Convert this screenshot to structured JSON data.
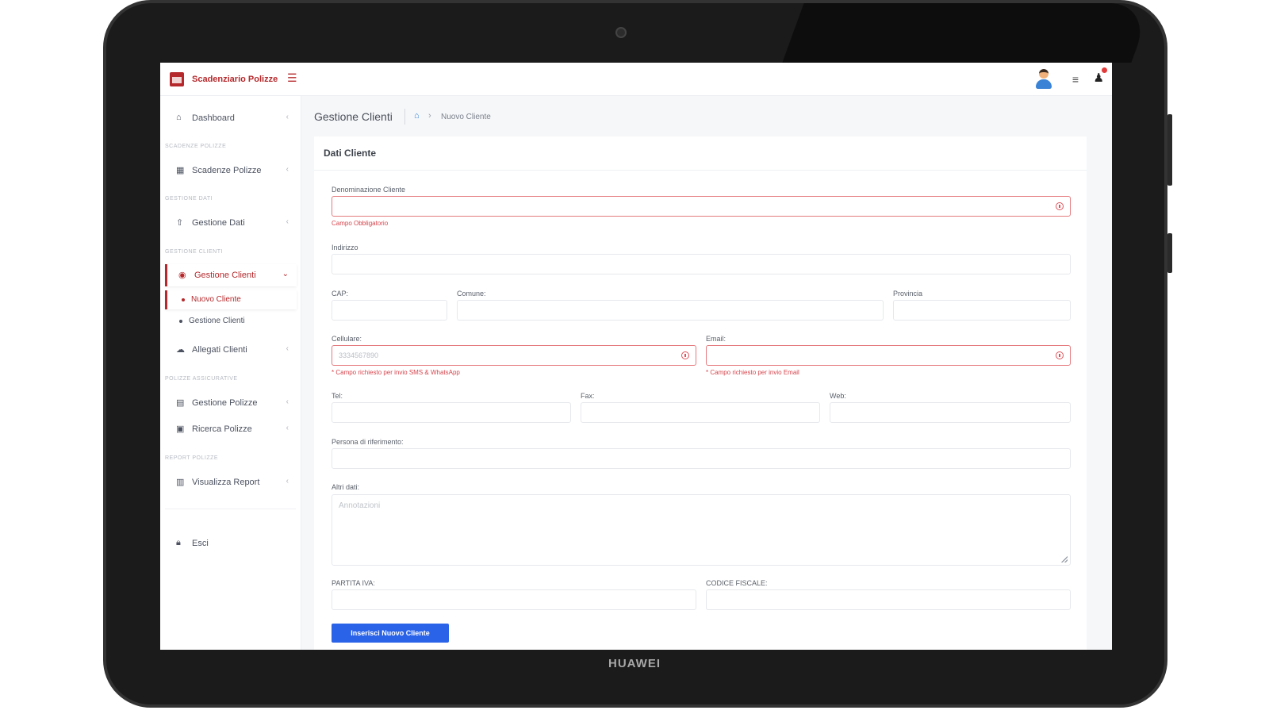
{
  "device": {
    "brand": "HUAWEI"
  },
  "app": {
    "title": "Scadenziario Polizze"
  },
  "sidebar": {
    "dashboard": "Dashboard",
    "sections": [
      "SCADENZE POLIZZE",
      "GESTIONE DATI",
      "GESTIONE CLIENTI",
      "POLIZZE ASSICURATIVE",
      "REPORT POLIZZE"
    ],
    "items": {
      "scadenze": "Scadenze Polizze",
      "gestione_dati": "Gestione Dati",
      "gestione_clienti": "Gestione Clienti",
      "nuovo_cliente": "Nuovo Cliente",
      "gestione_clienti_sub": "Gestione Clienti",
      "allegati": "Allegati Clienti",
      "gestione_polizze": "Gestione Polizze",
      "ricerca_polizze": "Ricerca Polizze",
      "report": "Visualizza Report",
      "esci": "Esci"
    }
  },
  "header": {
    "page_title": "Gestione Clienti",
    "breadcrumb_current": "Nuovo Cliente"
  },
  "form": {
    "title": "Dati Cliente",
    "denominazione": {
      "label": "Denominazione Cliente",
      "value": "",
      "error": "Campo Obbligatorio"
    },
    "indirizzo": {
      "label": "Indirizzo",
      "value": ""
    },
    "cap": {
      "label": "CAP:",
      "value": ""
    },
    "comune": {
      "label": "Comune:",
      "value": ""
    },
    "provincia": {
      "label": "Provincia",
      "value": ""
    },
    "cellulare": {
      "label": "Cellulare:",
      "placeholder": "3334567890",
      "hint": "* Campo richiesto per invio SMS & WhatsApp"
    },
    "email": {
      "label": "Email:",
      "value": "",
      "hint": "* Campo richiesto per invio Email"
    },
    "tel": {
      "label": "Tel:",
      "value": ""
    },
    "fax": {
      "label": "Fax:",
      "value": ""
    },
    "web": {
      "label": "Web:",
      "value": ""
    },
    "persona": {
      "label": "Persona di riferimento:",
      "value": ""
    },
    "altri_dati": {
      "label": "Altri dati:",
      "placeholder": "Annotazioni"
    },
    "partita_iva": {
      "label": "PARTITA IVA:",
      "value": ""
    },
    "codice_fiscale": {
      "label": "CODICE FISCALE:",
      "value": ""
    },
    "submit": "Inserisci Nuovo Cliente"
  },
  "colors": {
    "brand_red": "#b5282b",
    "primary_blue": "#2a63e8",
    "error_red": "#e0525a"
  }
}
